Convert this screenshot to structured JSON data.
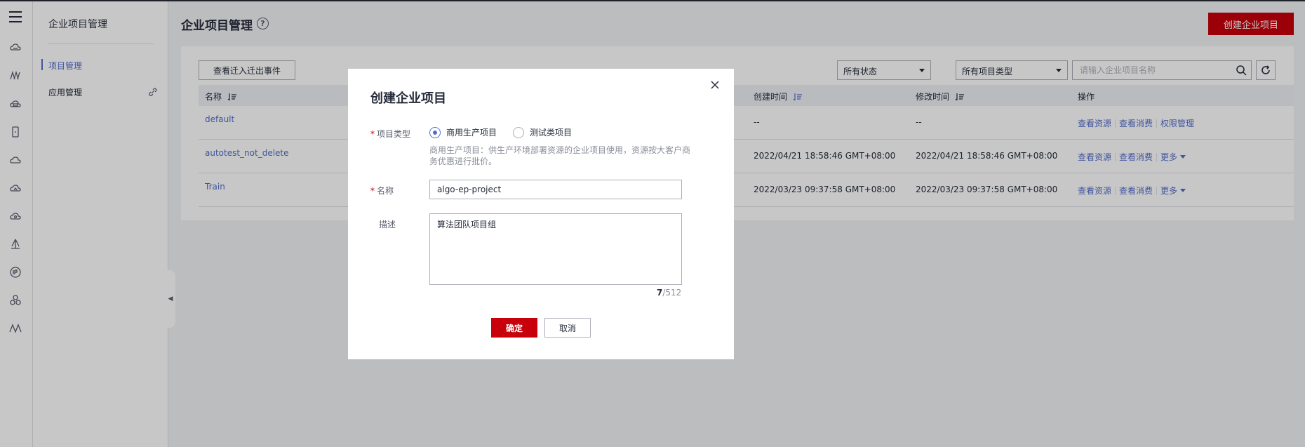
{
  "subnav": {
    "title": "企业项目管理",
    "items": [
      {
        "label": "项目管理"
      },
      {
        "label": "应用管理"
      }
    ]
  },
  "header": {
    "title": "企业项目管理",
    "help_icon": "?",
    "create_label": "创建企业项目"
  },
  "toolbar": {
    "event_button": "查看迁入迁出事件",
    "status_select": "所有状态",
    "type_select": "所有项目类型",
    "search_placeholder": "请输入企业项目名称"
  },
  "table": {
    "columns": {
      "name": "名称",
      "created": "创建时间",
      "modified": "修改时间",
      "ops": "操作"
    },
    "rows": [
      {
        "name": "default",
        "created": "--",
        "modified": "--",
        "op1": "查看资源",
        "op2": "查看消费",
        "op3": "权限管理"
      },
      {
        "name": "autotest_not_delete",
        "created": "2022/04/21 18:58:46 GMT+08:00",
        "modified": "2022/04/21 18:58:46 GMT+08:00",
        "op1": "查看资源",
        "op2": "查看消费",
        "op3": "更多"
      },
      {
        "name": "Train",
        "created": "2022/03/23 09:37:58 GMT+08:00",
        "modified": "2022/03/23 09:37:58 GMT+08:00",
        "op1": "查看资源",
        "op2": "查看消费",
        "op3": "更多"
      }
    ]
  },
  "modal": {
    "title": "创建企业项目",
    "type_label": "项目类型",
    "radio_prod": "商用生产项目",
    "radio_test": "测试类项目",
    "hint": "商用生产项目：供生产环境部署资源的企业项目使用，资源按大客户商务优惠进行批价。",
    "name_label": "名称",
    "name_value": "algo-ep-project",
    "desc_label": "描述",
    "desc_value": "算法团队项目组",
    "count_current": "7",
    "count_max": "/512",
    "ok_label": "确定",
    "cancel_label": "取消"
  },
  "colors": {
    "brand_red": "#c7000b",
    "link_blue": "#526ecc"
  },
  "icons": [
    "menu-icon",
    "cloud-icon",
    "server-icon",
    "database-icon",
    "phone-icon",
    "network-icon",
    "link-icon",
    "sort-icon",
    "search-icon",
    "refresh-icon",
    "close-icon",
    "collapse-arrow-icon"
  ]
}
